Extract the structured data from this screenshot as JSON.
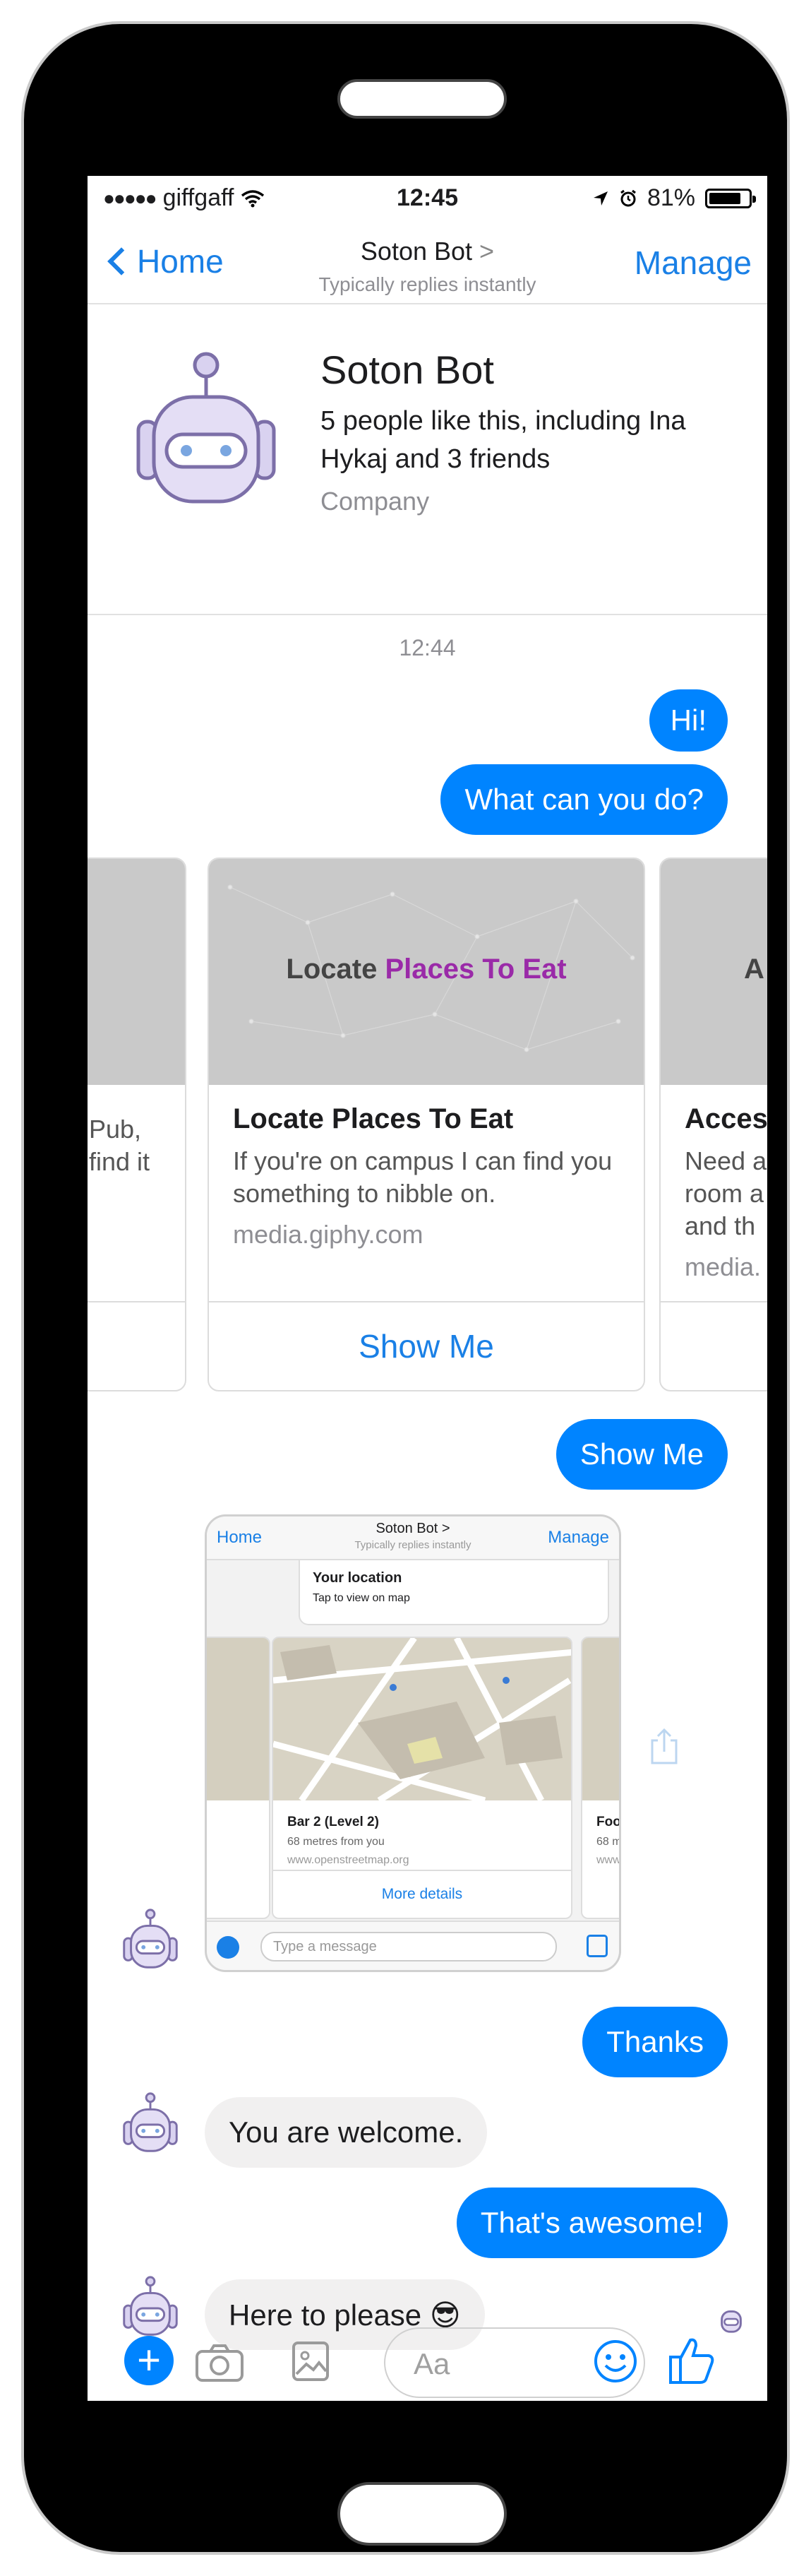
{
  "status_bar": {
    "carrier": "giffgaff",
    "time": "12:45",
    "battery": "81%",
    "battery_level": 0.81
  },
  "nav": {
    "back_label": "Home",
    "title": "Soton Bot",
    "title_chevron": ">",
    "subtitle": "Typically replies instantly",
    "manage_label": "Manage"
  },
  "profile": {
    "name": "Soton Bot",
    "likes": "5 people like this, including Ina Hykaj and 3 friends",
    "category": "Company"
  },
  "conversation": {
    "timestamp": "12:44",
    "messages": [
      {
        "from": "user",
        "text": "Hi!"
      },
      {
        "from": "user",
        "text": "What can you do?"
      },
      {
        "from": "user",
        "text": "Show Me"
      },
      {
        "from": "user",
        "text": "Thanks"
      },
      {
        "from": "bot",
        "text": "You are welcome."
      },
      {
        "from": "user",
        "text": "That's awesome!"
      },
      {
        "from": "bot",
        "text": "Here to please 😎"
      }
    ]
  },
  "carousel": {
    "left_card": {
      "desc_line1": "Pub,",
      "desc_line2": "find it"
    },
    "center_card": {
      "banner_plain": "Locate ",
      "banner_highlight": "Places To Eat",
      "title": "Locate Places To Eat",
      "description": "If you're on campus I can find you something to nibble on.",
      "source": "media.giphy.com",
      "button": "Show Me"
    },
    "right_card": {
      "banner": "A",
      "title": "Acces",
      "desc_line1": "Need a",
      "desc_line2": "room a",
      "desc_line3": "and th",
      "source": "media."
    }
  },
  "screenshot": {
    "back_label": "Home",
    "title": "Soton Bot >",
    "subtitle": "Typically replies instantly",
    "manage_label": "Manage",
    "location_title": "Your location",
    "location_sub": "Tap to view on map",
    "card_title": "Bar 2 (Level 2)",
    "card_distance": "68 metres from you",
    "card_url": "www.openstreetmap.org",
    "card_button": "More details",
    "right_title": "Food",
    "right_distance": "68 m",
    "right_url": "www.",
    "input_placeholder": "Type a message"
  },
  "composer": {
    "placeholder": "Aa"
  },
  "colors": {
    "messenger_blue": "#0084ff",
    "link_blue": "#1a80e6",
    "banner_purple": "#9a2aa8",
    "bot_purple": "#c9bfe6"
  }
}
